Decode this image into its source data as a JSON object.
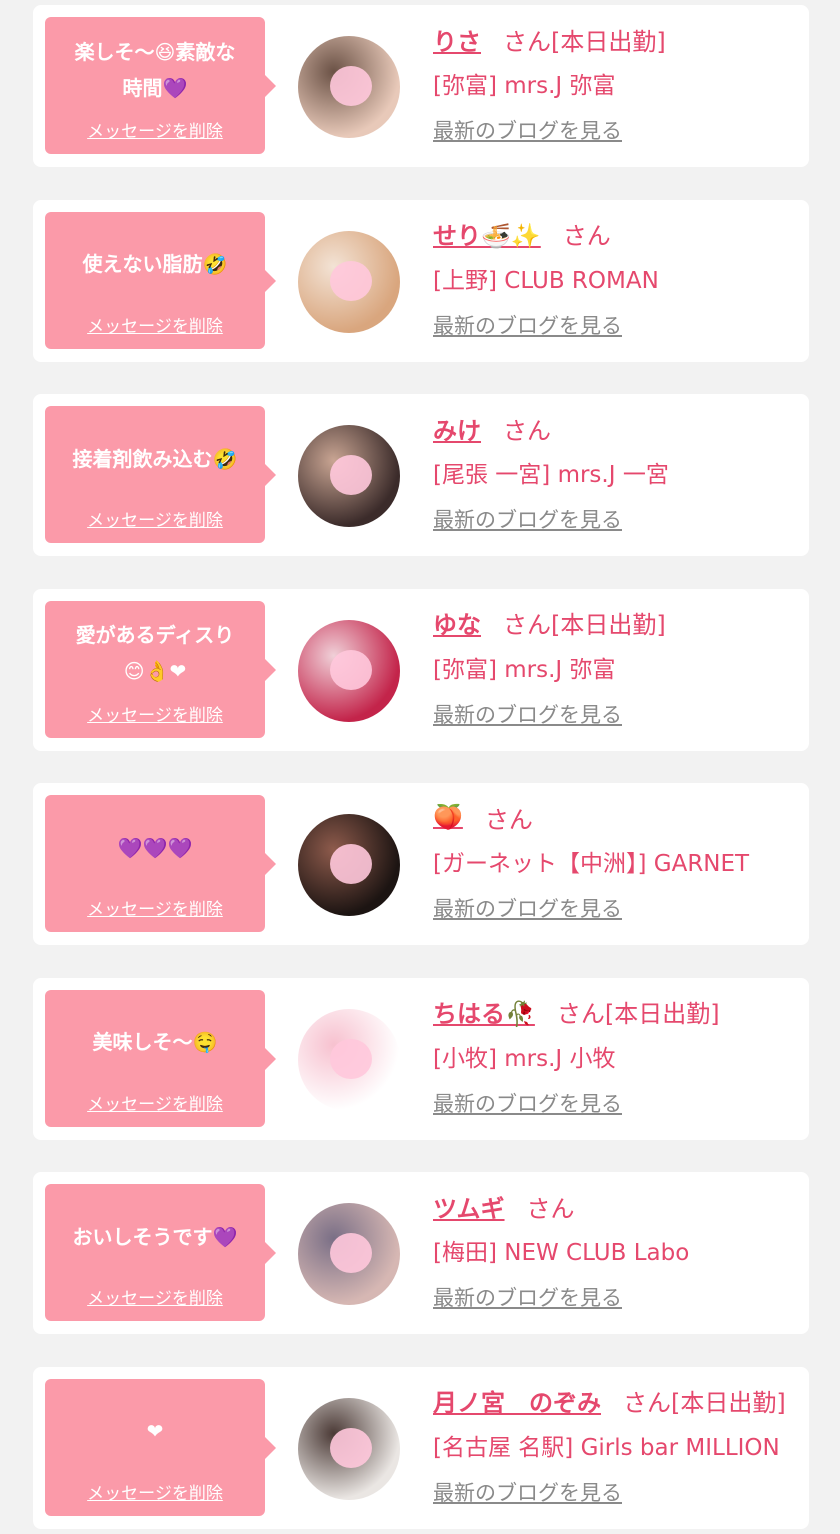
{
  "delete_label": "メッセージを削除",
  "blog_label": "最新のブログを見る",
  "items": [
    {
      "message": "楽しそ〜😆素敵な\n時間💜",
      "name": "りさ",
      "suffix": "さん[本日出勤]",
      "shop": "[弥富] mrs.J 弥富",
      "avatar_colors": [
        "#e8c9b9",
        "#6b5246"
      ]
    },
    {
      "message": "使えない脂肪🤣",
      "name": "せり🍜✨",
      "suffix": "さん",
      "shop": "[上野] CLUB ROMAN",
      "avatar_colors": [
        "#d9a67e",
        "#f3e3d5"
      ]
    },
    {
      "message": "接着剤飲み込む🤣",
      "name": "みけ",
      "suffix": "さん",
      "shop": "[尾張 一宮] mrs.J 一宮",
      "avatar_colors": [
        "#3b2b2a",
        "#c9a593"
      ]
    },
    {
      "message": "愛があるディスり\n😊👌❤",
      "name": "ゆな",
      "suffix": "さん[本日出勤]",
      "shop": "[弥富] mrs.J 弥富",
      "avatar_colors": [
        "#c3244a",
        "#f0d0d8"
      ]
    },
    {
      "message": "💜💜💜",
      "name": "🍑",
      "suffix": "さん",
      "shop": "[ガーネット【中洲】] GARNET",
      "avatar_colors": [
        "#1c1412",
        "#8e5b4c"
      ]
    },
    {
      "message": "美味しそ〜🤤",
      "name": "ちはる🥀",
      "suffix": "さん[本日出勤]",
      "shop": "[小牧] mrs.J 小牧",
      "avatar_colors": [
        "#ffffff",
        "#f7c1cf"
      ]
    },
    {
      "message": "おいしそうです💜",
      "name": "ツムギ",
      "suffix": "さん",
      "shop": "[梅田] NEW CLUB Labo",
      "avatar_colors": [
        "#d6b7b3",
        "#7a6f86"
      ]
    },
    {
      "message": "❤",
      "name": "月ノ宮　のぞみ",
      "suffix": "さん[本日出勤]",
      "shop": "[名古屋 名駅] Girls bar MILLION",
      "avatar_colors": [
        "#eae6e3",
        "#4b3a36"
      ]
    }
  ]
}
